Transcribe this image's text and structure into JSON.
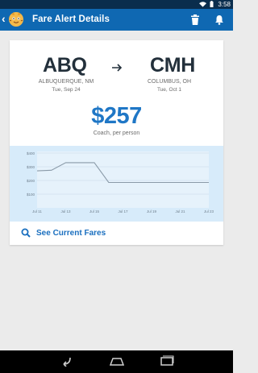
{
  "status_bar": {
    "time": "3:58"
  },
  "header": {
    "back_glyph": "‹",
    "title": "Fare Alert Details"
  },
  "route": {
    "origin": {
      "code": "ABQ",
      "city": "ALBUQUERQUE, NM",
      "date": "Tue, Sep 24"
    },
    "destination": {
      "code": "CMH",
      "city": "COLUMBUS, OH",
      "date": "Tue, Oct 1"
    }
  },
  "fare": {
    "price": "$257",
    "note": "Coach, per person"
  },
  "chart_data": {
    "type": "line",
    "title": "",
    "xlabel": "",
    "ylabel": "",
    "x": [
      "Jul 11",
      "Jul 12",
      "Jul 13",
      "Jul 14",
      "Jul 15",
      "Jul 16",
      "Jul 17",
      "Jul 18",
      "Jul 19",
      "Jul 20",
      "Jul 21",
      "Jul 22",
      "Jul 23"
    ],
    "x_tick_labels": [
      "Jul 11",
      "Jul 13",
      "Jul 15",
      "Jul 17",
      "Jul 19",
      "Jul 21",
      "Jul 23"
    ],
    "y_tick_labels": [
      "$400",
      "$300",
      "$200",
      "$100"
    ],
    "ylim": [
      0,
      400
    ],
    "values": [
      270,
      275,
      330,
      330,
      330,
      185,
      185,
      185,
      185,
      185,
      185,
      185,
      185
    ],
    "line_color": "#8a9aa8",
    "grid": true
  },
  "actions": {
    "see_fares": "See Current Fares"
  },
  "colors": {
    "accent": "#1f77c6",
    "action_bar": "#0f68b2",
    "chart_bg": "#d7ebfa"
  }
}
